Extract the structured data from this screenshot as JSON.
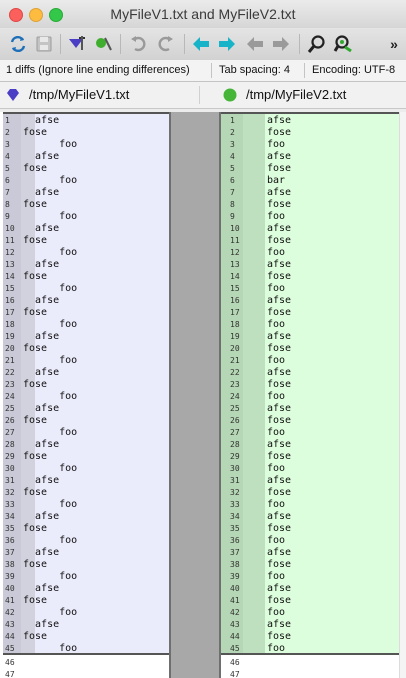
{
  "window": {
    "title": "MyFileV1.txt and MyFileV2.txt"
  },
  "toolbar": {
    "buttons": [
      "refresh-icon",
      "save-icon",
      "prev-conflict-icon",
      "next-conflict-icon",
      "undo-icon",
      "redo-icon",
      "copy-left-to-right-icon",
      "copy-right-to-left-icon",
      "previous-diff-icon",
      "next-diff-icon",
      "search-icon",
      "search-replace-icon"
    ],
    "overflow": "»"
  },
  "status": {
    "diffs": "1 diffs (Ignore line ending differences)",
    "tab_spacing": "Tab spacing: 4",
    "encoding": "Encoding: UTF-8"
  },
  "files": {
    "left_path": "/tmp/MyFileV1.txt",
    "right_path": "/tmp/MyFileV2.txt",
    "left_color": "#5a4fcf",
    "right_color": "#44b536"
  },
  "left_lines": [
    {
      "n": "1",
      "t": "  afse"
    },
    {
      "n": "2",
      "t": "fose"
    },
    {
      "n": "3",
      "t": "      foo"
    },
    {
      "n": "4",
      "t": "  afse"
    },
    {
      "n": "5",
      "t": "fose"
    },
    {
      "n": "6",
      "t": "      foo"
    },
    {
      "n": "7",
      "t": "  afse"
    },
    {
      "n": "8",
      "t": "fose"
    },
    {
      "n": "9",
      "t": "      foo"
    },
    {
      "n": "10",
      "t": "  afse"
    },
    {
      "n": "11",
      "t": "fose"
    },
    {
      "n": "12",
      "t": "      foo"
    },
    {
      "n": "13",
      "t": "  afse"
    },
    {
      "n": "14",
      "t": "fose"
    },
    {
      "n": "15",
      "t": "      foo"
    },
    {
      "n": "16",
      "t": "  afse"
    },
    {
      "n": "17",
      "t": "fose"
    },
    {
      "n": "18",
      "t": "      foo"
    },
    {
      "n": "19",
      "t": "  afse"
    },
    {
      "n": "20",
      "t": "fose"
    },
    {
      "n": "21",
      "t": "      foo"
    },
    {
      "n": "22",
      "t": "  afse"
    },
    {
      "n": "23",
      "t": "fose"
    },
    {
      "n": "24",
      "t": "      foo"
    },
    {
      "n": "25",
      "t": "  afse"
    },
    {
      "n": "26",
      "t": "fose"
    },
    {
      "n": "27",
      "t": "      foo"
    },
    {
      "n": "28",
      "t": "  afse"
    },
    {
      "n": "29",
      "t": "fose"
    },
    {
      "n": "30",
      "t": "      foo"
    },
    {
      "n": "31",
      "t": "  afse"
    },
    {
      "n": "32",
      "t": "fose"
    },
    {
      "n": "33",
      "t": "      foo"
    },
    {
      "n": "34",
      "t": "  afse"
    },
    {
      "n": "35",
      "t": "fose"
    },
    {
      "n": "36",
      "t": "      foo"
    },
    {
      "n": "37",
      "t": "  afse"
    },
    {
      "n": "38",
      "t": "fose"
    },
    {
      "n": "39",
      "t": "      foo"
    },
    {
      "n": "40",
      "t": "  afse"
    },
    {
      "n": "41",
      "t": "fose"
    },
    {
      "n": "42",
      "t": "      foo"
    },
    {
      "n": "43",
      "t": "  afse"
    },
    {
      "n": "44",
      "t": "fose"
    },
    {
      "n": "45",
      "t": "      foo"
    },
    {
      "n": "46",
      "t": ""
    },
    {
      "n": "47",
      "t": ""
    }
  ],
  "right_lines": [
    {
      "n": "1",
      "t": "afse"
    },
    {
      "n": "2",
      "t": "fose"
    },
    {
      "n": "3",
      "t": "foo"
    },
    {
      "n": "4",
      "t": "afse"
    },
    {
      "n": "5",
      "t": "fose"
    },
    {
      "n": "6",
      "t": "bar"
    },
    {
      "n": "7",
      "t": "afse"
    },
    {
      "n": "8",
      "t": "fose"
    },
    {
      "n": "9",
      "t": "foo"
    },
    {
      "n": "10",
      "t": "afse"
    },
    {
      "n": "11",
      "t": "fose"
    },
    {
      "n": "12",
      "t": "foo"
    },
    {
      "n": "13",
      "t": "afse"
    },
    {
      "n": "14",
      "t": "fose"
    },
    {
      "n": "15",
      "t": "foo"
    },
    {
      "n": "16",
      "t": "afse"
    },
    {
      "n": "17",
      "t": "fose"
    },
    {
      "n": "18",
      "t": "foo"
    },
    {
      "n": "19",
      "t": "afse"
    },
    {
      "n": "20",
      "t": "fose"
    },
    {
      "n": "21",
      "t": "foo"
    },
    {
      "n": "22",
      "t": "afse"
    },
    {
      "n": "23",
      "t": "fose"
    },
    {
      "n": "24",
      "t": "foo"
    },
    {
      "n": "25",
      "t": "afse"
    },
    {
      "n": "26",
      "t": "fose"
    },
    {
      "n": "27",
      "t": "foo"
    },
    {
      "n": "28",
      "t": "afse"
    },
    {
      "n": "29",
      "t": "fose"
    },
    {
      "n": "30",
      "t": "foo"
    },
    {
      "n": "31",
      "t": "afse"
    },
    {
      "n": "32",
      "t": "fose"
    },
    {
      "n": "33",
      "t": "foo"
    },
    {
      "n": "34",
      "t": "afse"
    },
    {
      "n": "35",
      "t": "fose"
    },
    {
      "n": "36",
      "t": "foo"
    },
    {
      "n": "37",
      "t": "afse"
    },
    {
      "n": "38",
      "t": "fose"
    },
    {
      "n": "39",
      "t": "foo"
    },
    {
      "n": "40",
      "t": "afse"
    },
    {
      "n": "41",
      "t": "fose"
    },
    {
      "n": "42",
      "t": "foo"
    },
    {
      "n": "43",
      "t": "afse"
    },
    {
      "n": "44",
      "t": "fose"
    },
    {
      "n": "45",
      "t": "foo"
    },
    {
      "n": "46",
      "t": ""
    },
    {
      "n": "47",
      "t": ""
    }
  ]
}
